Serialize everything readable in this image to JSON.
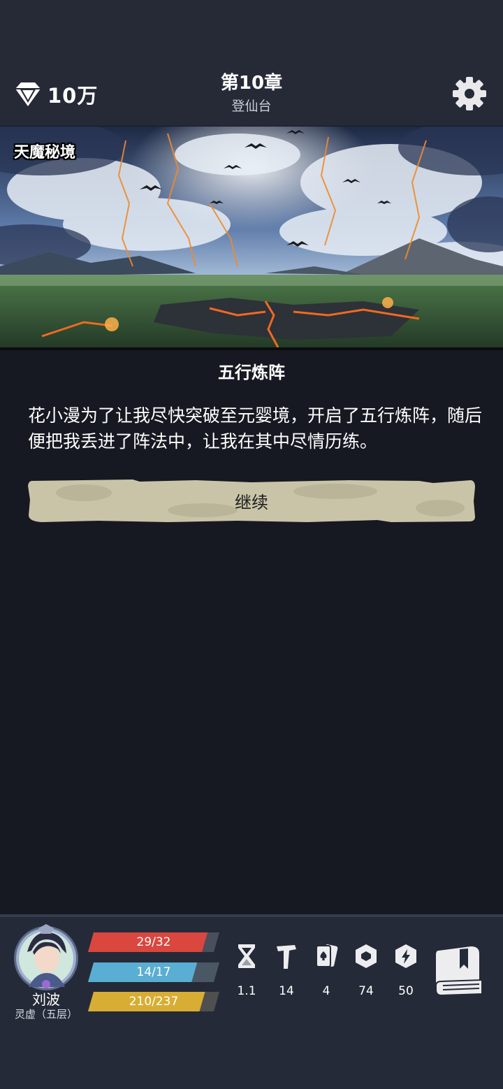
{
  "header": {
    "gem_count": "10万",
    "chapter_title": "第10章",
    "chapter_subtitle": "登仙台"
  },
  "banner": {
    "location_label": "天魔秘境"
  },
  "event": {
    "title": "五行炼阵",
    "text": "花小漫为了让我尽快突破至元婴境，开启了五行炼阵，随后便把我丢进了阵法中，让我在其中尽情历练。",
    "continue_label": "继续"
  },
  "character": {
    "name": "刘波",
    "realm": "灵虚（五层）",
    "hp": {
      "text": "29/32",
      "current": 29,
      "max": 32,
      "color": "#d9473f"
    },
    "mp": {
      "text": "14/17",
      "current": 14,
      "max": 17,
      "color": "#5aaed3"
    },
    "exp": {
      "text": "210/237",
      "current": 210,
      "max": 237,
      "color": "#d8ad33"
    }
  },
  "attributes": [
    {
      "icon": "hourglass-icon",
      "value": "1.1"
    },
    {
      "icon": "hammer-icon",
      "value": "14"
    },
    {
      "icon": "card-spade-icon",
      "value": "4"
    },
    {
      "icon": "shield-hex-icon",
      "value": "74"
    },
    {
      "icon": "lightning-hex-icon",
      "value": "50"
    }
  ],
  "colors": {
    "background": "#161922",
    "header_bg": "#262a37",
    "button_parchment": "#c9c4a8"
  }
}
